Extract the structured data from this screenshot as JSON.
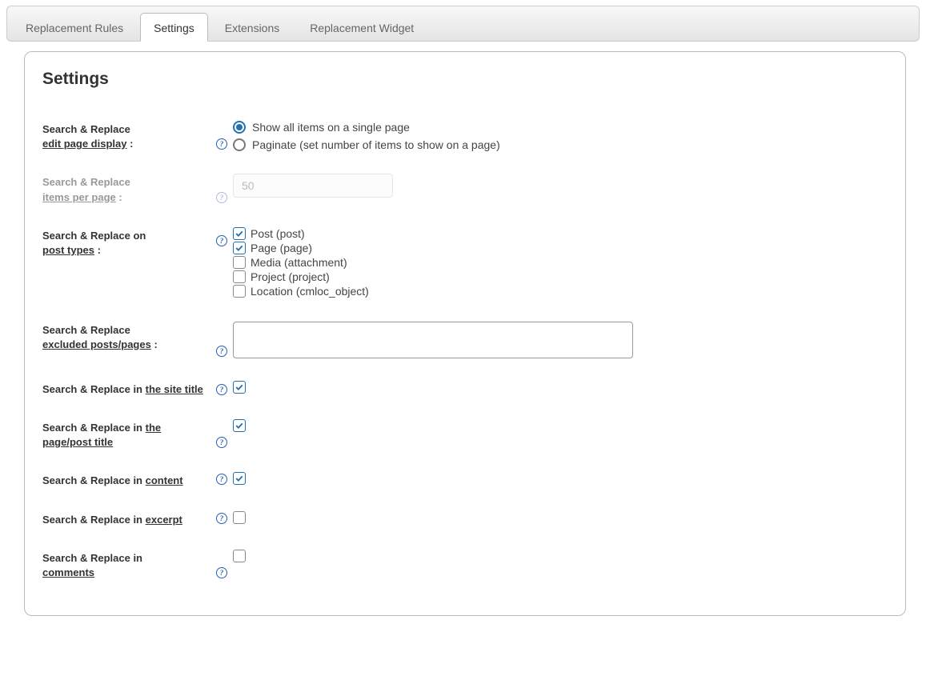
{
  "tabs": {
    "rules": "Replacement Rules",
    "settings": "Settings",
    "extensions": "Extensions",
    "widget": "Replacement Widget"
  },
  "page_title": "Settings",
  "rows": {
    "display": {
      "label_pre": "Search & Replace",
      "label_ul": "edit page display",
      "label_suf": " :",
      "opt1": "Show all items on a single page",
      "opt2": "Paginate (set number of items to show on a page)"
    },
    "per_page": {
      "label_pre": "Search & Replace",
      "label_ul": "items per page",
      "label_suf": " :",
      "value": "50"
    },
    "post_types": {
      "label_pre": "Search & Replace on",
      "label_ul": "post types",
      "label_suf": " :",
      "items": [
        {
          "label": "Post (post)",
          "checked": true
        },
        {
          "label": "Page (page)",
          "checked": true
        },
        {
          "label": "Media (attachment)",
          "checked": false
        },
        {
          "label": "Project (project)",
          "checked": false
        },
        {
          "label": "Location (cmloc_object)",
          "checked": false
        }
      ]
    },
    "excluded": {
      "label_pre": "Search & Replace",
      "label_ul": "excluded posts/pages",
      "label_suf": " :"
    },
    "site_title": {
      "label_pre": "Search & Replace in ",
      "label_ul": "the site title",
      "checked": true
    },
    "post_title": {
      "label_pre": "Search & Replace in ",
      "label_ul": "the page/post title",
      "checked": true
    },
    "content": {
      "label_pre": "Search & Replace in ",
      "label_ul": "content",
      "checked": true
    },
    "excerpt": {
      "label_pre": "Search & Replace in ",
      "label_ul": "excerpt",
      "checked": false
    },
    "comments": {
      "label_pre": "Search & Replace in",
      "label_ul": "comments",
      "checked": false
    }
  },
  "help_glyph": "?"
}
